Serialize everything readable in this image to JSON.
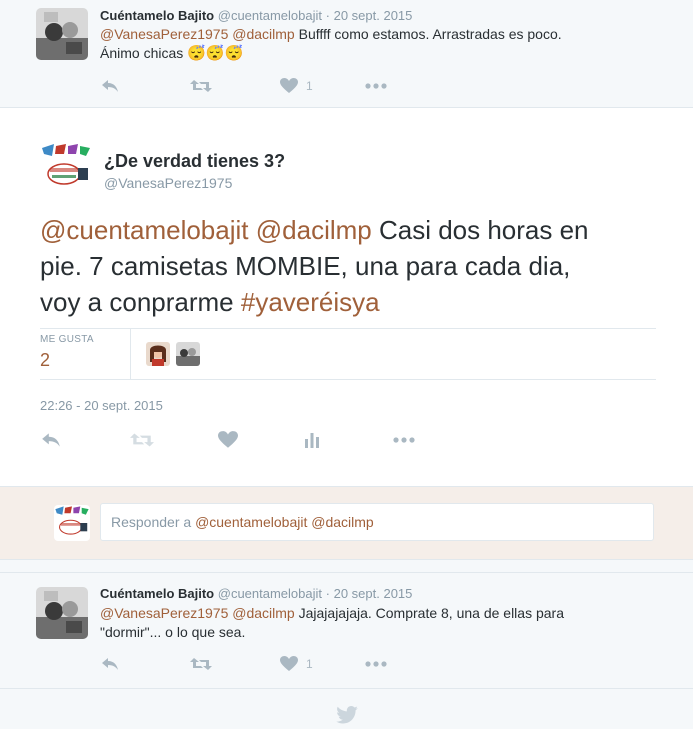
{
  "tweet1": {
    "author_name": "Cuéntamelo Bajito",
    "handle": "@cuentamelobajit",
    "sep": "·",
    "date": "20 sept. 2015",
    "mention1": "@VanesaPerez1975",
    "mention2": "@dacilmp",
    "text": " Buffff como estamos. Arrastradas es poco.",
    "text2": "Ánimo chicas",
    "emoji": "😴😴😴",
    "like_count": "1"
  },
  "main_tweet": {
    "author_name": "¿De verdad tienes 3?",
    "handle": "@VanesaPerez1975",
    "mention1": "@cuentamelobajit",
    "mention2": "@dacilmp",
    "text_part1": " Casi dos horas en",
    "text_line2": "pie. 7 camisetas MOMBIE, una para cada dia,",
    "text_line3": "voy a conprarme ",
    "hashtag": "#yaveréisya",
    "likes_label": "ME GUSTA",
    "likes_count": "2",
    "timestamp": "22:26 - 20 sept. 2015"
  },
  "reply": {
    "placeholder_prefix": "Responder a ",
    "mention1": "@cuentamelobajit",
    "mention2": "@dacilmp"
  },
  "tweet2": {
    "author_name": "Cuéntamelo Bajito",
    "handle": "@cuentamelobajit",
    "sep": "·",
    "date": "20 sept. 2015",
    "mention1": "@VanesaPerez1975",
    "mention2": "@dacilmp",
    "text": " Jajajajajaja. Comprate 8, una de ellas para",
    "text2": "\"dormir\"... o lo que sea.",
    "like_count": "1"
  },
  "colors": {
    "link": "#a0603a",
    "icon": "#aab8c2",
    "muted": "#8899a6"
  },
  "icons": [
    "reply-icon",
    "retweet-icon",
    "heart-icon",
    "more-icon",
    "analytics-icon",
    "twitter-bird-icon"
  ]
}
